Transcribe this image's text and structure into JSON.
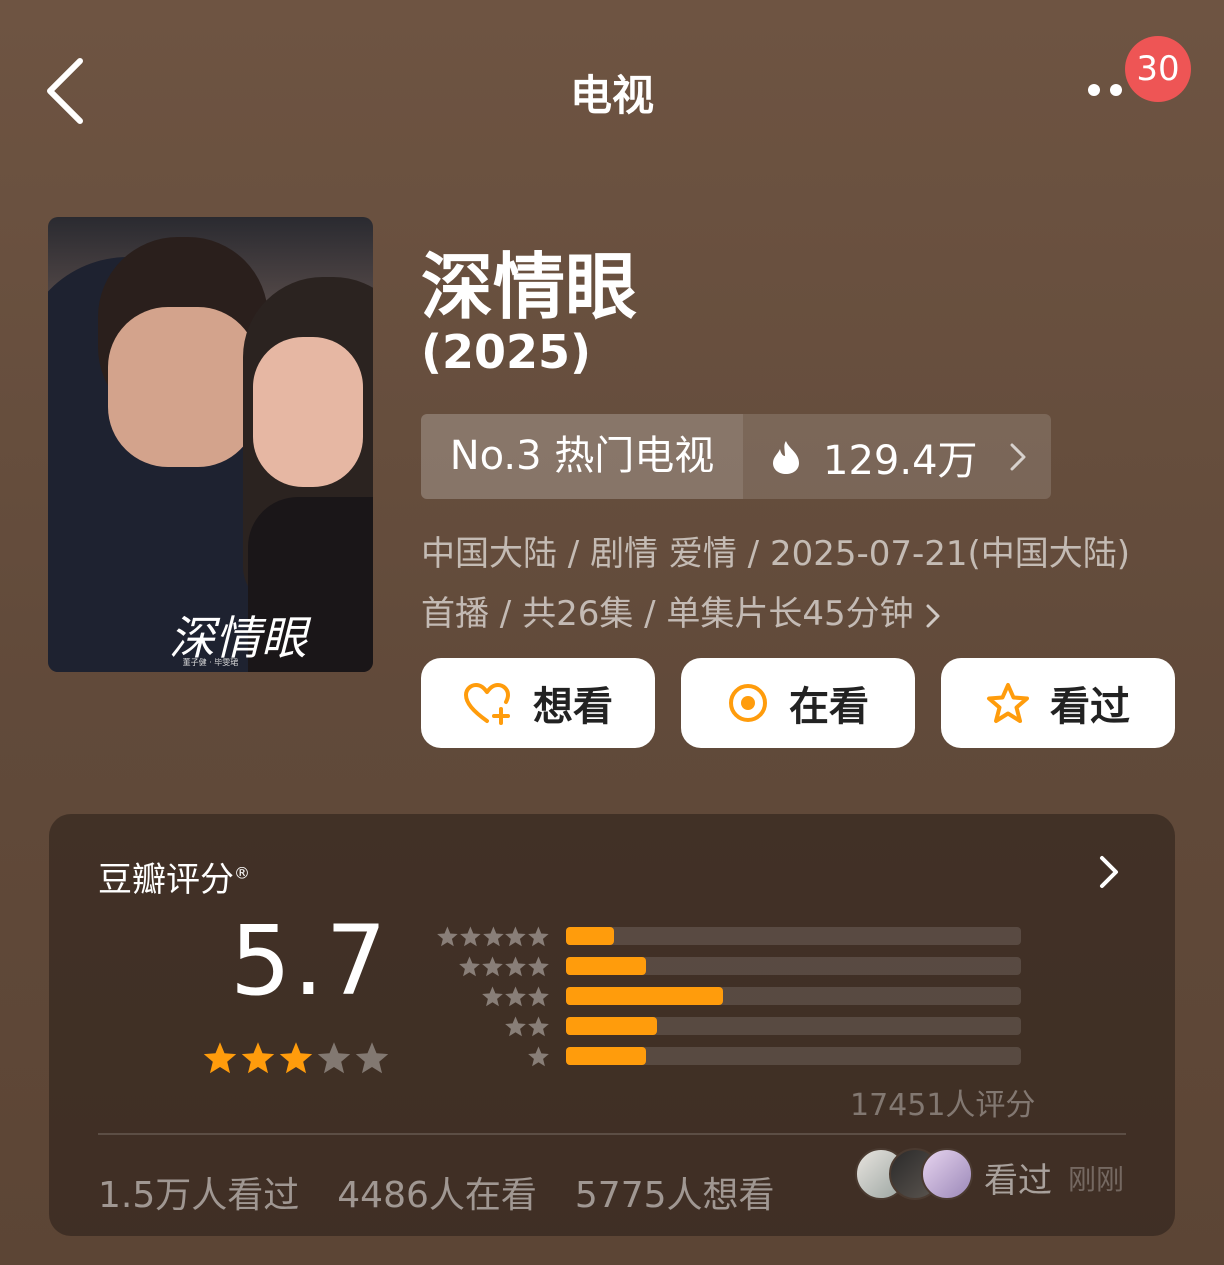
{
  "nav": {
    "title": "电视",
    "notification_count": "30"
  },
  "poster": {
    "title_art": "深情眼",
    "credits": "董子健 · 毕雯珺"
  },
  "show": {
    "title": "深情眼",
    "year": "(2025)"
  },
  "rank": {
    "label": "No.3 热门电视",
    "heat": "129.4万"
  },
  "meta": {
    "line1": "中国大陆 / 剧情 爱情 / 2025-07-21(中国大陆)",
    "line2": "首播 / 共26集 / 单集片长45分钟"
  },
  "actions": {
    "want": "想看",
    "watching": "在看",
    "watched": "看过"
  },
  "rating": {
    "label": "豆瓣评分",
    "mark": "®",
    "score": "5.7",
    "stars_filled": 3,
    "stars_total": 5,
    "distribution": [
      {
        "stars": 5,
        "percent": 10.5
      },
      {
        "stars": 4,
        "percent": 17.5
      },
      {
        "stars": 3,
        "percent": 34.5
      },
      {
        "stars": 2,
        "percent": 20
      },
      {
        "stars": 1,
        "percent": 17.5
      }
    ],
    "raters": "17451人评分"
  },
  "stats": {
    "watched": "1.5万人看过",
    "watching": "4486人在看",
    "want": "5775人想看"
  },
  "activity": {
    "action": "看过",
    "time": "刚刚"
  },
  "colors": {
    "accent": "#ff9c0c",
    "badge": "#ee5555",
    "background": "#6a5140"
  }
}
